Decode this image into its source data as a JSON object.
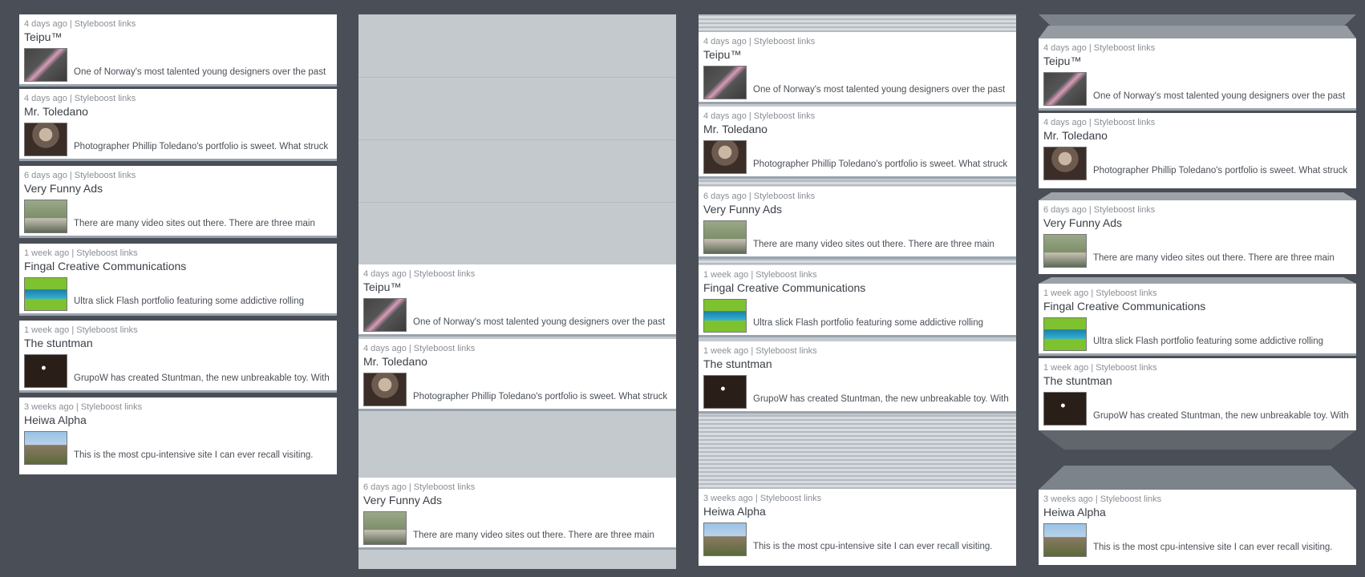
{
  "posts": [
    {
      "meta": "4 days ago | Styleboost links",
      "title": "Teipu™",
      "desc": "One of Norway's most talented young designers over the past",
      "thumb": "pink-graphic-thumbnail"
    },
    {
      "meta": "4 days ago | Styleboost links",
      "title": "Mr. Toledano",
      "desc": "Photographer Phillip Toledano's portfolio is sweet. What struck",
      "thumb": "portrait-photo-thumbnail"
    },
    {
      "meta": "6 days ago | Styleboost links",
      "title": "Very Funny Ads",
      "desc": "There are many video sites out there. There are three main",
      "thumb": "field-photo-thumbnail"
    },
    {
      "meta": "1 week ago | Styleboost links",
      "title": "Fingal Creative Communications",
      "desc": "Ultra slick Flash portfolio featuring some addictive rolling",
      "thumb": "green-flash-thumbnail"
    },
    {
      "meta": "1 week ago | Styleboost links",
      "title": "The stuntman",
      "desc": "GrupoW has created Stuntman, the new unbreakable toy. With",
      "thumb": "dark-night-thumbnail"
    },
    {
      "meta": "3 weeks ago | Styleboost links",
      "title": "Heiwa Alpha",
      "desc": "This is the most cpu-intensive site I can ever recall visiting.",
      "thumb": "robot-illustration-thumbnail"
    }
  ]
}
